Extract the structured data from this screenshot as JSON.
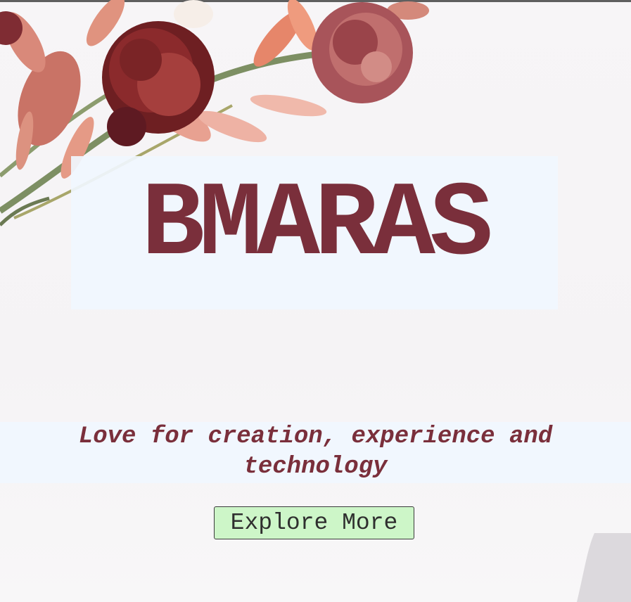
{
  "hero": {
    "title": "BMARAS",
    "tagline": "Love for creation, experience and technology",
    "explore_button_label": "Explore More",
    "background_image": "pink-and-burgundy-dried-flowers-photo",
    "brand_color": "#7a2f3b",
    "button_color": "#cdf6c8",
    "highlight_color": "#f0f6fe"
  }
}
